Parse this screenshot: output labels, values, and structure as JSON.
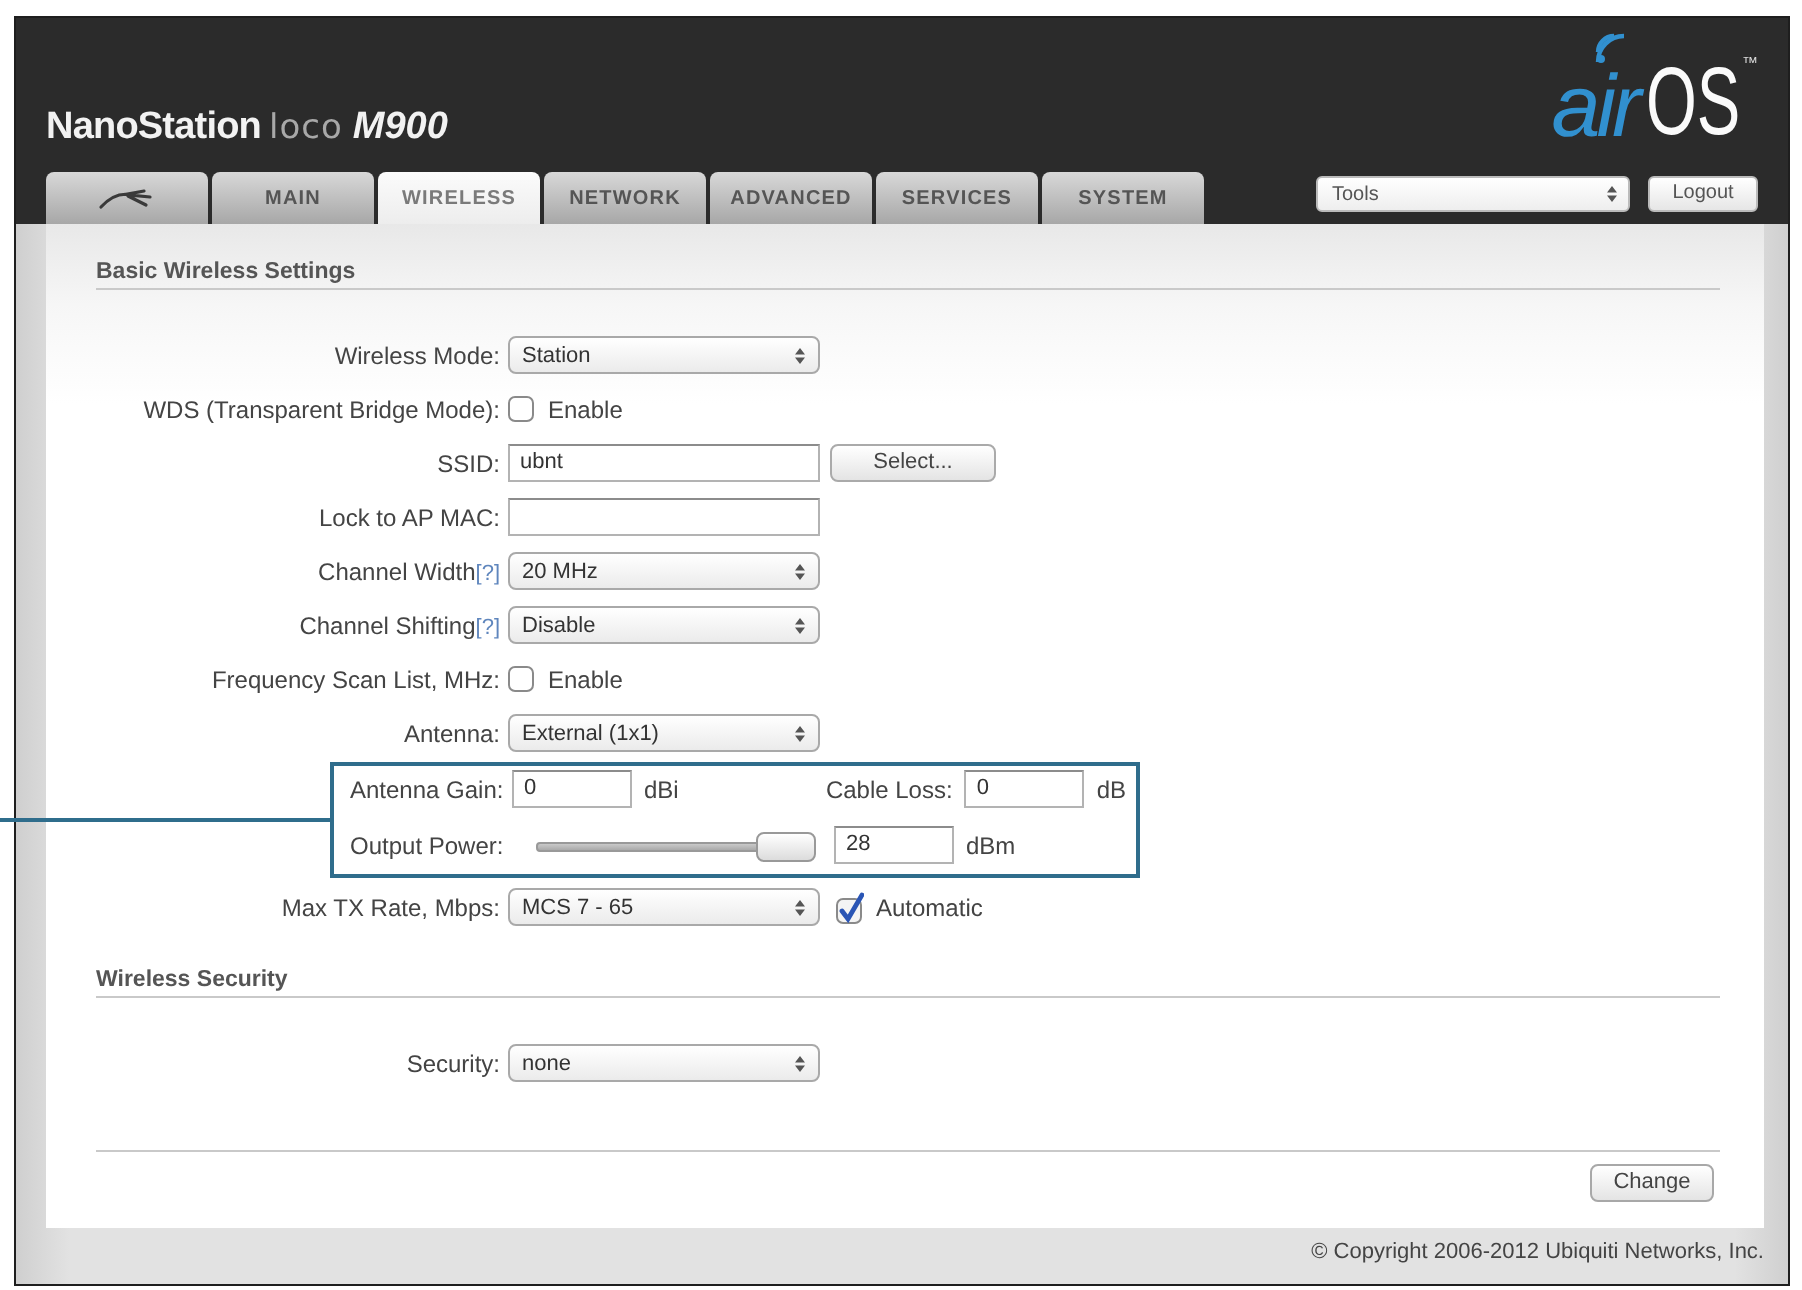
{
  "header": {
    "product": {
      "name": "NanoStation",
      "series": "loco",
      "model": "M900"
    },
    "brand": {
      "air": "air",
      "os": "OS",
      "trademark": "™"
    }
  },
  "tabs": [
    {
      "kind": "logo",
      "selected": false
    },
    {
      "kind": "text",
      "label": "MAIN",
      "selected": false
    },
    {
      "kind": "text",
      "label": "WIRELESS",
      "selected": true
    },
    {
      "kind": "text",
      "label": "NETWORK",
      "selected": false
    },
    {
      "kind": "text",
      "label": "ADVANCED",
      "selected": false
    },
    {
      "kind": "text",
      "label": "SERVICES",
      "selected": false
    },
    {
      "kind": "text",
      "label": "SYSTEM",
      "selected": false
    }
  ],
  "tools": {
    "value": "Tools"
  },
  "logout": "Logout",
  "sections": [
    {
      "title": "Basic Wireless Settings",
      "rows": [
        {
          "kind": "select",
          "label": "Wireless Mode:",
          "value": "Station"
        },
        {
          "kind": "checkbox",
          "label": "WDS (Transparent Bridge Mode):",
          "option": {
            "label": "Enable",
            "checked": false
          }
        },
        {
          "kind": "input",
          "label": "SSID:",
          "value": "ubnt",
          "button": "Select..."
        },
        {
          "kind": "input",
          "label": "Lock to AP MAC:"
        },
        {
          "kind": "select",
          "label": "Channel Width",
          "help": "[?]",
          "value": "20 MHz"
        },
        {
          "kind": "select",
          "label": "Channel Shifting",
          "help": "[?]",
          "value": "Disable"
        },
        {
          "kind": "checkbox",
          "label": "Frequency Scan List, MHz:",
          "option": {
            "label": "Enable",
            "checked": false
          }
        },
        {
          "kind": "select",
          "label": "Antenna:",
          "value": "External (1x1)"
        },
        {
          "kind": "callout",
          "rows": [
            {
              "kind": "pair",
              "fields": [
                {
                  "label": "Antenna Gain:",
                  "value": "0",
                  "unit": "dBi"
                },
                {
                  "label": "Cable Loss:",
                  "value": "0",
                  "unit": "dB"
                }
              ]
            },
            {
              "kind": "slider",
              "label": "Output Power:",
              "level": 1,
              "value": "28",
              "unit": "dBm"
            }
          ]
        },
        {
          "kind": "select",
          "label": "Max TX Rate, Mbps:",
          "value": "MCS 7 - 65",
          "option": {
            "label": "Automatic",
            "checked": true
          }
        }
      ]
    },
    {
      "title": "Wireless Security",
      "rows": [
        {
          "kind": "select",
          "label": "Security:",
          "value": "none"
        }
      ]
    }
  ],
  "change_button": "Change",
  "copyright": "© Copyright 2006-2012 Ubiquiti Networks, Inc."
}
